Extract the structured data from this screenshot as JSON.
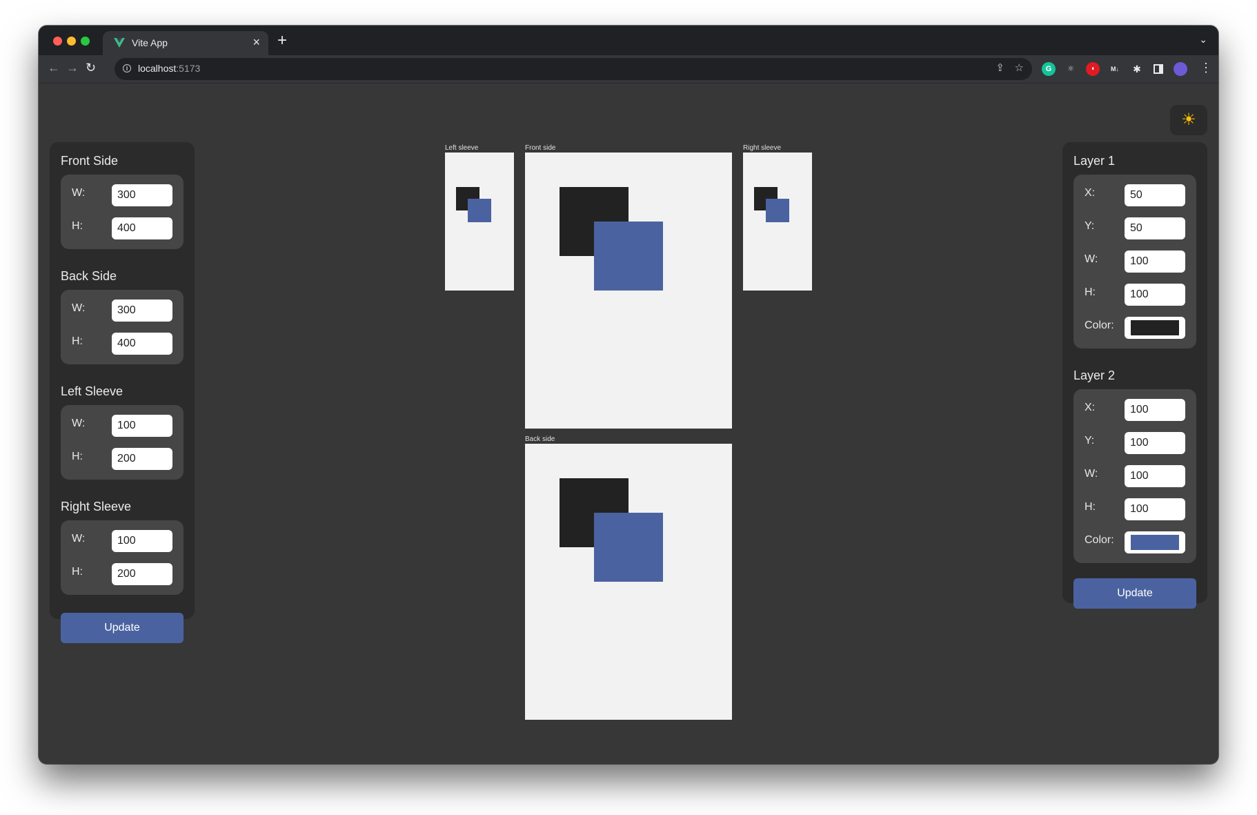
{
  "browser": {
    "tab_title": "Vite App",
    "tab_close": "×",
    "new_tab": "+",
    "tab_dropdown": "⌄",
    "url_host": "localhost",
    "url_port": ":5173",
    "back_icon": "←",
    "forward_icon": "→",
    "reload_icon": "↻",
    "share_icon": "⇪",
    "bookmark_icon": "☆",
    "menu_icon": "⋮",
    "extensions": [
      "grammarly-icon",
      "react-devtools-icon",
      "redirect-icon",
      "markdown-icon",
      "puzzle-icon",
      "sidepanel-icon",
      "profile-avatar"
    ]
  },
  "theme_toggle": {
    "icon": "☀",
    "icon_name": "sun-icon"
  },
  "left_panel": {
    "groups": [
      {
        "title": "Front Side",
        "fields": [
          {
            "label": "W:",
            "value": "300"
          },
          {
            "label": "H:",
            "value": "400"
          }
        ]
      },
      {
        "title": "Back Side",
        "fields": [
          {
            "label": "W:",
            "value": "300"
          },
          {
            "label": "H:",
            "value": "400"
          }
        ]
      },
      {
        "title": "Left Sleeve",
        "fields": [
          {
            "label": "W:",
            "value": "100"
          },
          {
            "label": "H:",
            "value": "200"
          }
        ]
      },
      {
        "title": "Right Sleeve",
        "fields": [
          {
            "label": "W:",
            "value": "100"
          },
          {
            "label": "H:",
            "value": "200"
          }
        ]
      }
    ],
    "update_label": "Update"
  },
  "right_panel": {
    "layers": [
      {
        "title": "Layer 1",
        "fields": [
          {
            "label": "X:",
            "value": "50"
          },
          {
            "label": "Y:",
            "value": "50"
          },
          {
            "label": "W:",
            "value": "100"
          },
          {
            "label": "H:",
            "value": "100"
          }
        ],
        "color_label": "Color:",
        "color": "#222222"
      },
      {
        "title": "Layer 2",
        "fields": [
          {
            "label": "X:",
            "value": "100"
          },
          {
            "label": "Y:",
            "value": "100"
          },
          {
            "label": "W:",
            "value": "100"
          },
          {
            "label": "H:",
            "value": "100"
          }
        ],
        "color_label": "Color:",
        "color": "#4a63a0"
      }
    ],
    "update_label": "Update"
  },
  "canvases": {
    "left_sleeve": "Left sleeve",
    "front": "Front side",
    "right_sleeve": "Right sleeve",
    "back": "Back side"
  },
  "colors": {
    "accent": "#4a63a0",
    "layer1": "#222222",
    "layer2": "#4a63a0",
    "canvas_bg": "#f2f2f2",
    "page_bg": "#373737",
    "panel_bg": "#2b2b2b"
  }
}
